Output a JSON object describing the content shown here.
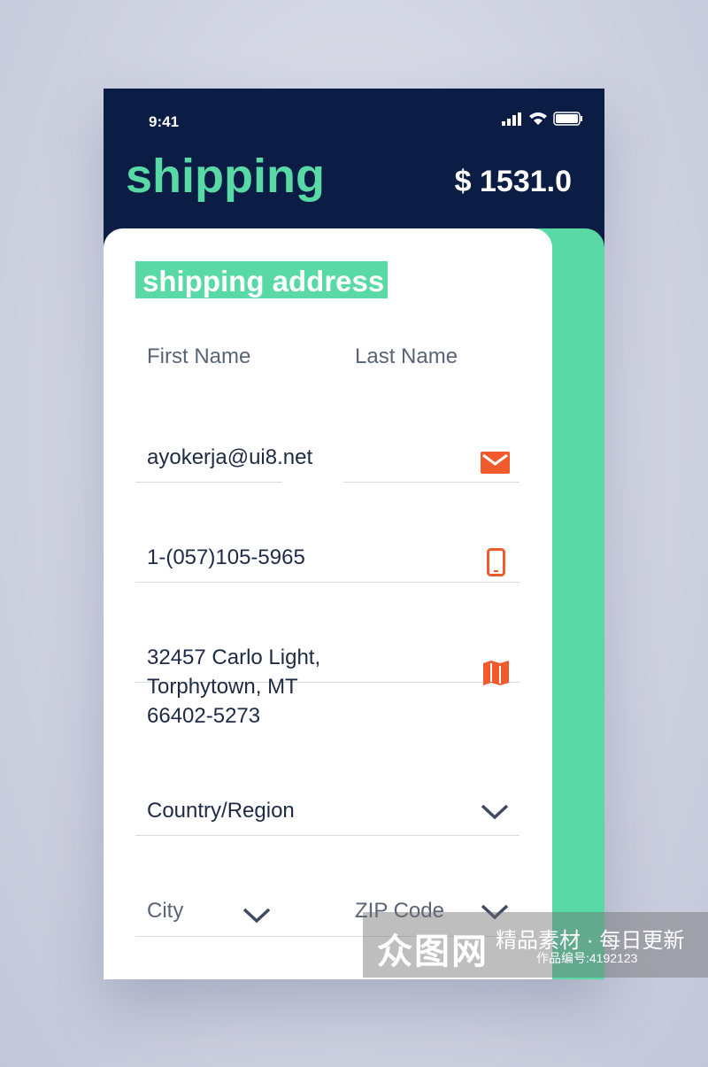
{
  "status_bar": {
    "time": "9:41"
  },
  "header": {
    "title": "shipping",
    "total": "$ 1531.0"
  },
  "form": {
    "section_title": "shipping address",
    "first_name_placeholder": "First Name",
    "last_name_placeholder": "Last Name",
    "email": "ayokerja@ui8.net",
    "phone": "1-(057)105-5965",
    "address_lines": [
      "32457 Carlo Light,",
      "Torphytown, MT",
      "66402-5273"
    ],
    "country_placeholder": "Country/Region",
    "city_placeholder": "City",
    "zip_placeholder": "ZIP Code"
  },
  "colors": {
    "navy": "#0b1c45",
    "accent": "#58d9a6",
    "icon": "#f05a2c"
  },
  "watermark": {
    "logo": "众图网",
    "slogan": "精品素材 · 每日更新",
    "id": "作品编号:4192123"
  }
}
